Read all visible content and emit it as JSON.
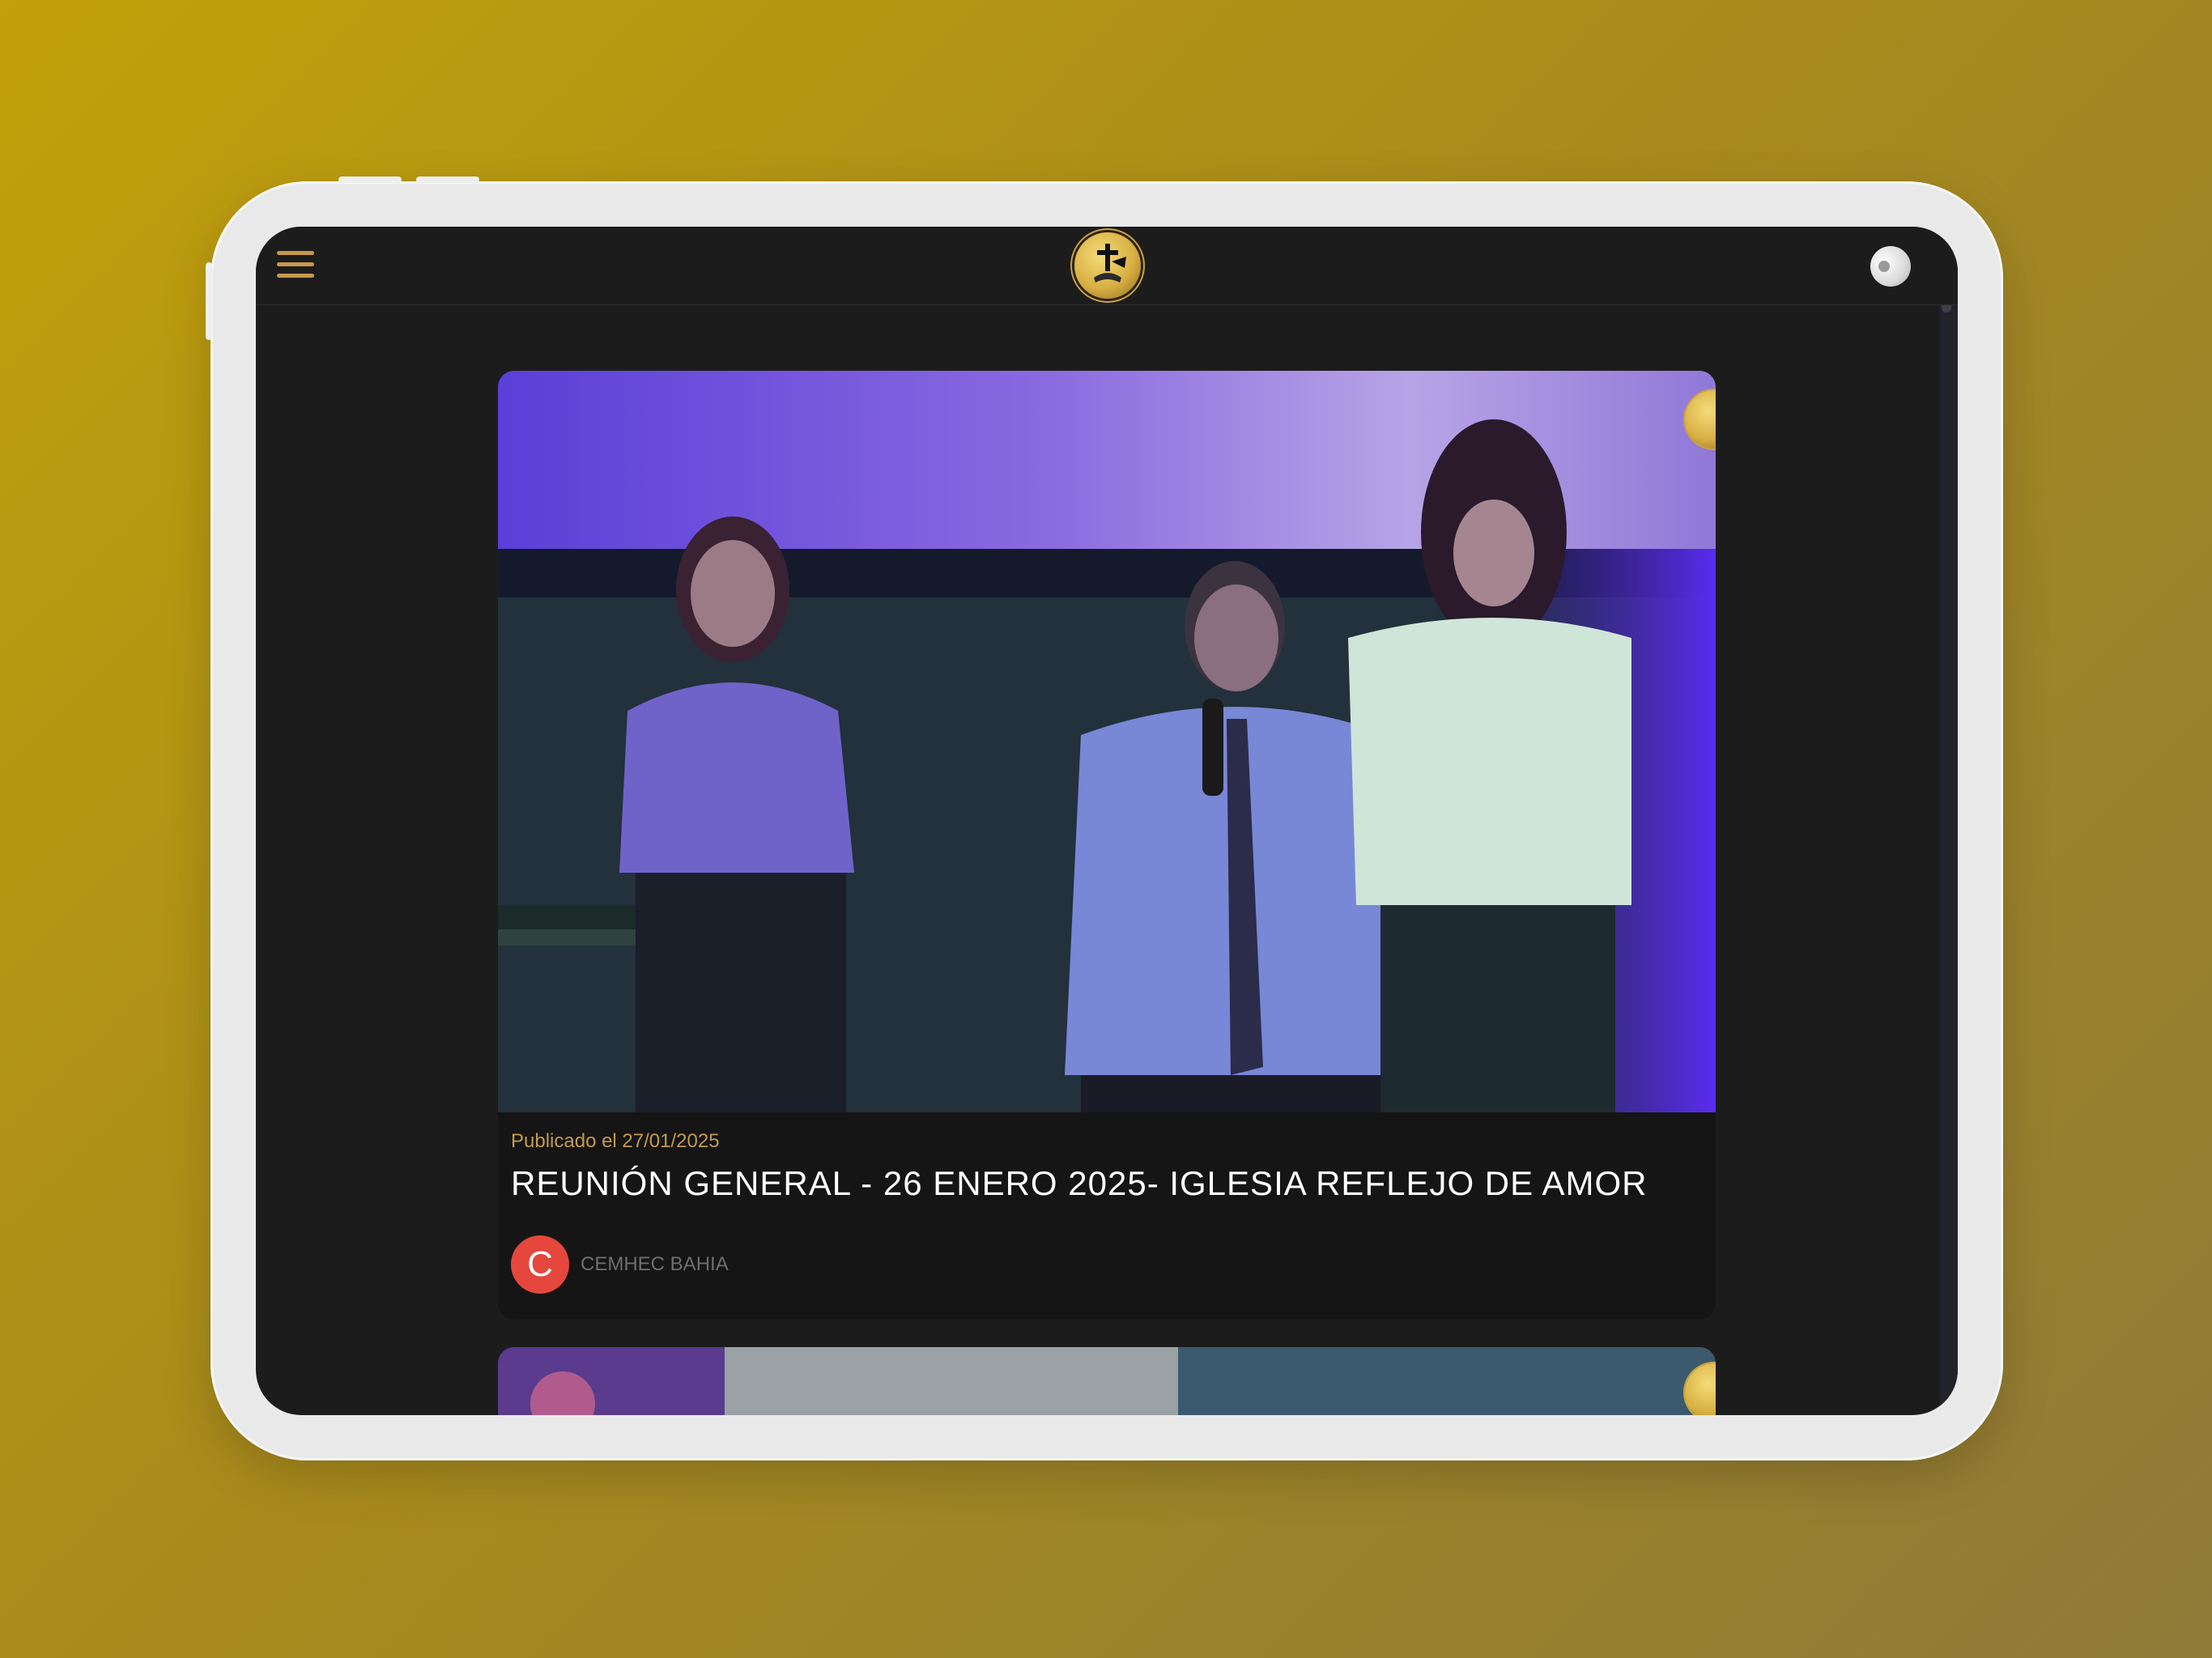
{
  "header": {
    "menu_icon": "hamburger-menu-icon",
    "logo_icon": "cross-hands-logo-icon",
    "user_icon": "user-avatar-icon"
  },
  "video": {
    "published": "Publicado el 27/01/2025",
    "title": "REUNIÓN GENERAL - 26 ENERO 2025- IGLESIA REFLEJO DE AMOR",
    "channel_initial": "C",
    "channel_name": "CEMHEC BAHIA"
  },
  "colors": {
    "accent": "#c49a4a",
    "background": "#1c1c1c",
    "card": "#151515",
    "channel_avatar": "#e5473c"
  }
}
